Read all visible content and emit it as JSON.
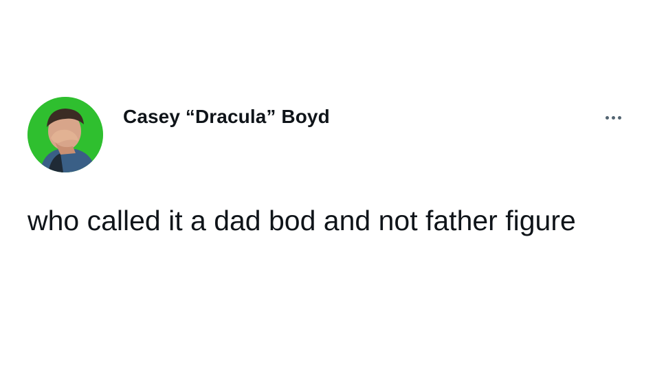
{
  "tweet": {
    "author": {
      "display_name": "Casey “Dracula” Boyd",
      "avatar_icon": "person-facepalm-avatar",
      "avatar_bg": "#2fbf2f"
    },
    "more_icon": "more-horizontal-icon",
    "text": "who called it a dad bod and not father figure"
  }
}
